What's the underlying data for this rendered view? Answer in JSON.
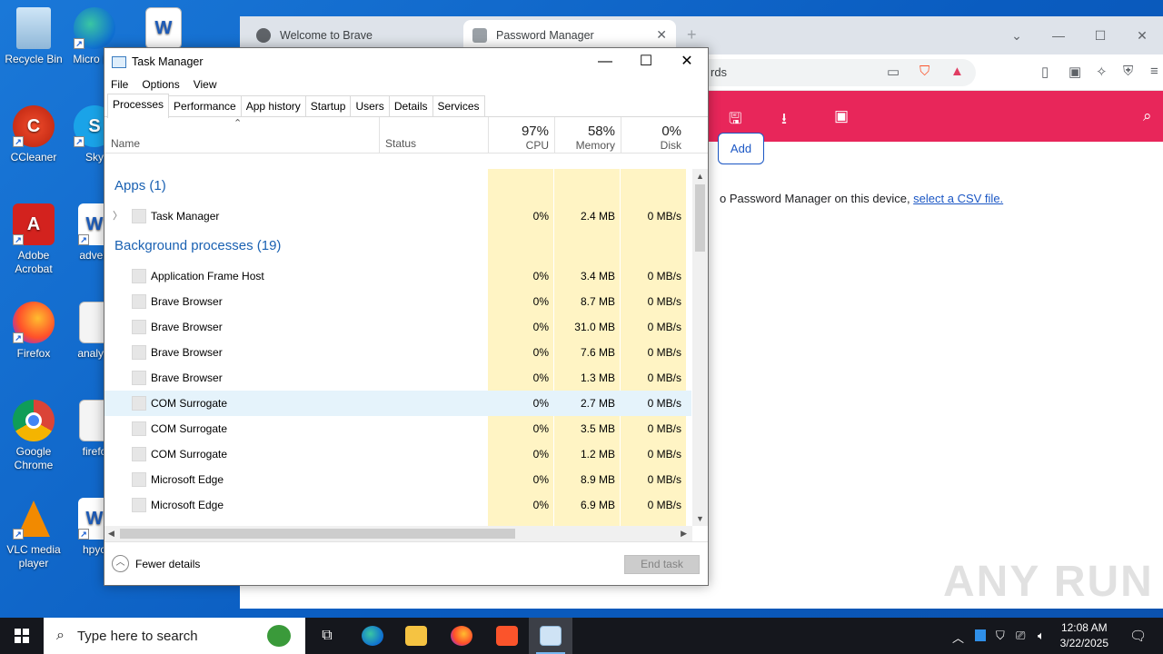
{
  "desktop": {
    "icons": [
      {
        "label": "Recycle Bin",
        "icon": "recycle-bin-icon"
      },
      {
        "label": "Micro Ed",
        "icon": "edge-icon"
      },
      {
        "label": "CCleaner",
        "icon": "ccleaner-icon"
      },
      {
        "label": "Sky",
        "icon": "skype-icon"
      },
      {
        "label": "Adobe Acrobat",
        "icon": "acrobat-icon"
      },
      {
        "label": "advert",
        "icon": "word-doc-icon"
      },
      {
        "label": "Firefox",
        "icon": "firefox-icon"
      },
      {
        "label": "analysi",
        "icon": "image-file-icon"
      },
      {
        "label": "Google Chrome",
        "icon": "chrome-icon"
      },
      {
        "label": "firefo",
        "icon": "image-file-icon"
      },
      {
        "label": "VLC media player",
        "icon": "vlc-icon"
      },
      {
        "label": "hpyo",
        "icon": "word-doc-icon"
      }
    ]
  },
  "browser": {
    "tabs": [
      {
        "label": "Welcome to Brave"
      },
      {
        "label": "Password Manager"
      }
    ],
    "address_tail": "rds",
    "page": {
      "add_label": "Add",
      "csv_prefix": "o Password Manager on this device, ",
      "csv_link": "select a CSV file."
    }
  },
  "task_manager": {
    "title": "Task Manager",
    "menu": [
      "File",
      "Options",
      "View"
    ],
    "tabs": [
      "Processes",
      "Performance",
      "App history",
      "Startup",
      "Users",
      "Details",
      "Services"
    ],
    "columns": {
      "name": "Name",
      "status": "Status",
      "cpu": {
        "pct": "97%",
        "label": "CPU"
      },
      "memory": {
        "pct": "58%",
        "label": "Memory"
      },
      "disk": {
        "pct": "0%",
        "label": "Disk"
      }
    },
    "groups": {
      "apps": "Apps (1)",
      "background": "Background processes (19)"
    },
    "apps": [
      {
        "name": "Task Manager",
        "cpu": "0%",
        "mem": "2.4 MB",
        "disk": "0 MB/s"
      }
    ],
    "background": [
      {
        "name": "Application Frame Host",
        "cpu": "0%",
        "mem": "3.4 MB",
        "disk": "0 MB/s"
      },
      {
        "name": "Brave Browser",
        "cpu": "0%",
        "mem": "8.7 MB",
        "disk": "0 MB/s"
      },
      {
        "name": "Brave Browser",
        "cpu": "0%",
        "mem": "31.0 MB",
        "disk": "0 MB/s"
      },
      {
        "name": "Brave Browser",
        "cpu": "0%",
        "mem": "7.6 MB",
        "disk": "0 MB/s"
      },
      {
        "name": "Brave Browser",
        "cpu": "0%",
        "mem": "1.3 MB",
        "disk": "0 MB/s"
      },
      {
        "name": "COM Surrogate",
        "cpu": "0%",
        "mem": "2.7 MB",
        "disk": "0 MB/s"
      },
      {
        "name": "COM Surrogate",
        "cpu": "0%",
        "mem": "3.5 MB",
        "disk": "0 MB/s"
      },
      {
        "name": "COM Surrogate",
        "cpu": "0%",
        "mem": "1.2 MB",
        "disk": "0 MB/s"
      },
      {
        "name": "Microsoft Edge",
        "cpu": "0%",
        "mem": "8.9 MB",
        "disk": "0 MB/s"
      },
      {
        "name": "Microsoft Edge",
        "cpu": "0%",
        "mem": "6.9 MB",
        "disk": "0 MB/s"
      }
    ],
    "footer": {
      "fewer_details": "Fewer details",
      "end_task": "End task"
    }
  },
  "taskbar": {
    "search_placeholder": "Type here to search",
    "time": "12:08 AM",
    "date": "3/22/2025"
  },
  "watermark": "ANY RUN"
}
